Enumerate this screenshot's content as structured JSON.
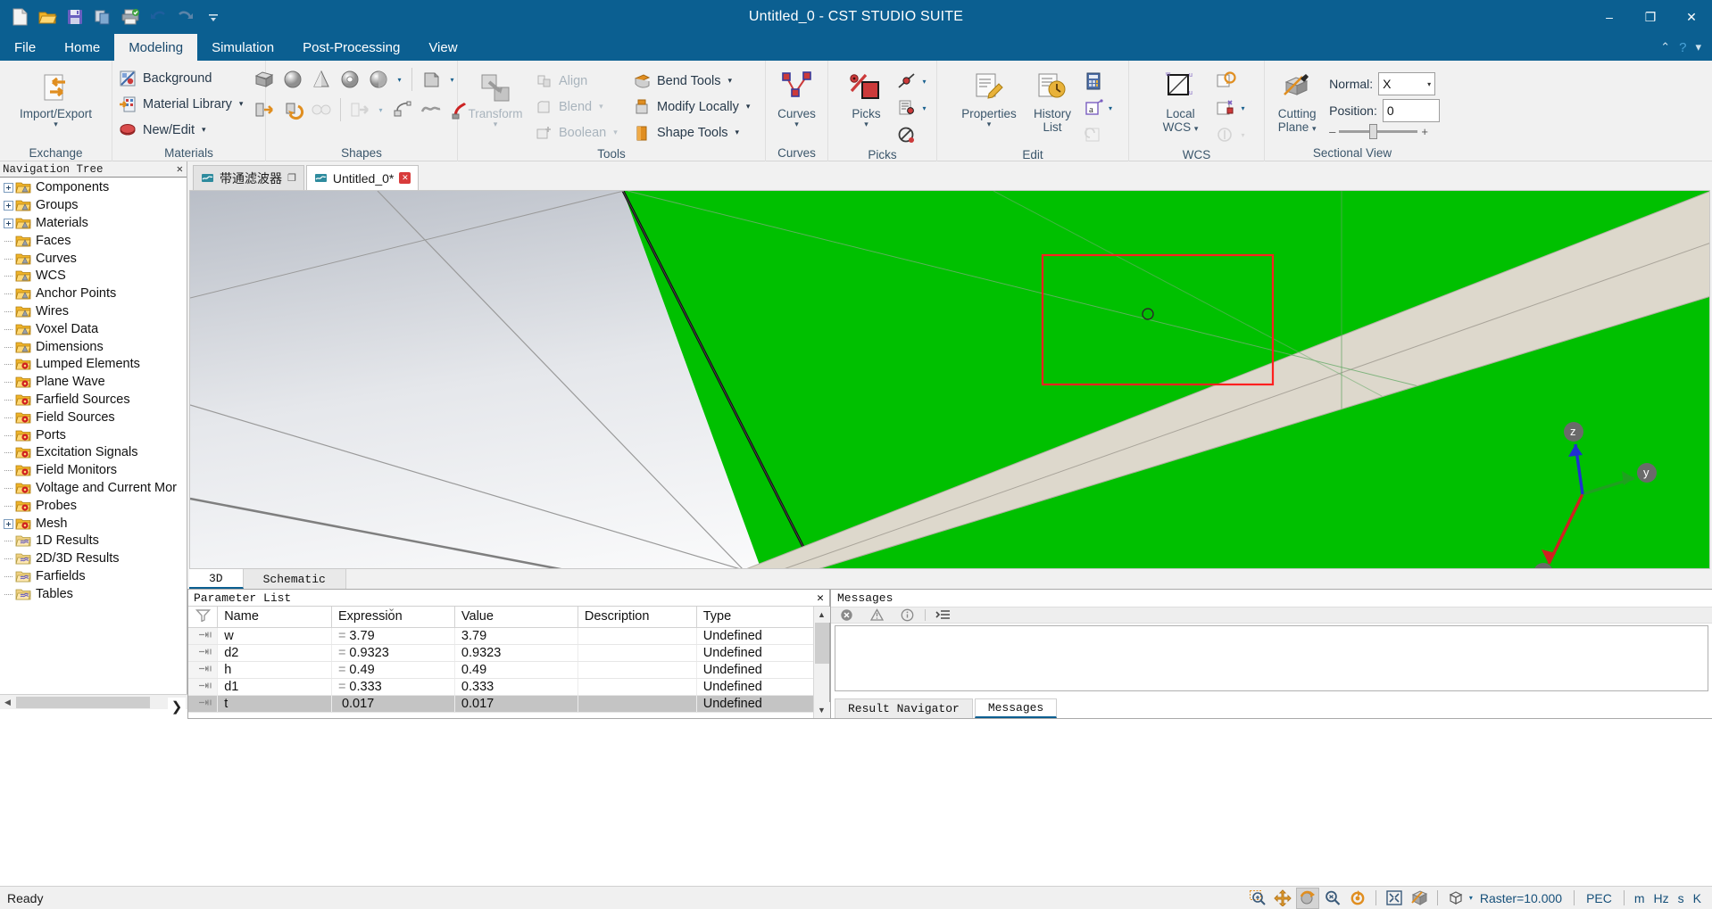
{
  "window": {
    "title": "Untitled_0 - CST STUDIO SUITE",
    "minimize": "–",
    "restore": "❐",
    "close": "✕"
  },
  "quick_access": [
    {
      "name": "new-document-icon",
      "tip": "New"
    },
    {
      "name": "open-folder-icon",
      "tip": "Open"
    },
    {
      "name": "save-icon",
      "tip": "Save"
    },
    {
      "name": "copy-icon",
      "tip": "Copy"
    },
    {
      "name": "print-icon",
      "tip": "Print"
    },
    {
      "name": "undo-icon",
      "tip": "Undo"
    },
    {
      "name": "redo-icon",
      "tip": "Redo"
    },
    {
      "name": "customize-qat-icon",
      "tip": "Customize"
    }
  ],
  "ribbon": {
    "tabs": [
      {
        "label": "File",
        "active": false
      },
      {
        "label": "Home",
        "active": false
      },
      {
        "label": "Modeling",
        "active": true
      },
      {
        "label": "Simulation",
        "active": false
      },
      {
        "label": "Post-Processing",
        "active": false
      },
      {
        "label": "View",
        "active": false
      }
    ],
    "help_icons": [
      {
        "name": "collapse-ribbon-icon",
        "glyph": "⌃"
      },
      {
        "name": "help-icon",
        "glyph": "?"
      },
      {
        "name": "ribbon-options-icon",
        "glyph": "▾"
      }
    ],
    "groups": {
      "exchange": {
        "label": "Exchange",
        "big_button": {
          "label": "Import/Export",
          "icon": "import-export-icon",
          "caret": "▾"
        }
      },
      "materials": {
        "label": "Materials",
        "items": [
          {
            "label": "Background",
            "icon": "background-icon",
            "dropdown": false,
            "disabled": false
          },
          {
            "label": "Material Library",
            "icon": "material-library-icon",
            "dropdown": true,
            "disabled": false
          },
          {
            "label": "New/Edit",
            "icon": "new-edit-material-icon",
            "dropdown": true,
            "disabled": false
          }
        ]
      },
      "shapes": {
        "label": "Shapes",
        "row1": [
          {
            "name": "brick-icon"
          },
          {
            "name": "sphere-icon"
          },
          {
            "name": "cone-icon"
          },
          {
            "name": "torus-icon"
          },
          {
            "name": "elliptical-cylinder-icon"
          },
          {
            "name": "shapes-more-caret",
            "caret": true
          },
          {
            "name": "extrude-icon"
          },
          {
            "name": "extrude-more-caret",
            "caret": true
          }
        ],
        "row2": [
          {
            "name": "extrude-curve-icon"
          },
          {
            "name": "rotate-icon"
          },
          {
            "name": "loft-icon",
            "disabled": true
          },
          {
            "name": "trace-from-curve-icon",
            "disabled": true
          },
          {
            "name": "trace-more-caret",
            "caret": true,
            "disabled": true
          },
          {
            "name": "wire-icon",
            "disabled": false
          },
          {
            "name": "curve-wire-icon"
          },
          {
            "name": "bond-wire-icon"
          }
        ]
      },
      "tools": {
        "label": "Tools",
        "big_button": {
          "label": "Transform",
          "icon": "transform-icon",
          "caret": "▾"
        },
        "col1": [
          {
            "label": "Align",
            "icon": "align-icon",
            "dropdown": false,
            "disabled": true
          },
          {
            "label": "Blend",
            "icon": "blend-icon",
            "dropdown": true,
            "disabled": true
          },
          {
            "label": "Boolean",
            "icon": "boolean-icon",
            "dropdown": true,
            "disabled": true
          }
        ],
        "col2": [
          {
            "label": "Bend Tools",
            "icon": "bend-tools-icon",
            "dropdown": true,
            "disabled": false
          },
          {
            "label": "Modify Locally",
            "icon": "modify-locally-icon",
            "dropdown": true,
            "disabled": false
          },
          {
            "label": "Shape Tools",
            "icon": "shape-tools-icon",
            "dropdown": true,
            "disabled": false
          }
        ]
      },
      "curves": {
        "label": "Curves",
        "big_button": {
          "label": "Curves",
          "icon": "curves-icon",
          "caret": "▾"
        }
      },
      "picks": {
        "label": "Picks",
        "big_button": {
          "label": "Picks",
          "icon": "picks-icon",
          "caret": "▾"
        },
        "side": [
          {
            "name": "pick-edge-icon",
            "caret": true
          },
          {
            "name": "pick-from-list-icon",
            "caret": true
          },
          {
            "name": "clear-picks-icon",
            "caret": false
          }
        ]
      },
      "edit": {
        "label": "Edit",
        "big_buttons": [
          {
            "label": "Properties",
            "icon": "properties-icon",
            "caret": "▾"
          },
          {
            "label": "History List",
            "icon": "history-list-icon",
            "caret": ""
          }
        ],
        "side": [
          {
            "name": "calculator-icon",
            "caret": false
          },
          {
            "name": "parameters-icon",
            "caret": true
          },
          {
            "name": "update-parametric-icon",
            "caret": false,
            "disabled": true
          }
        ]
      },
      "wcs": {
        "label": "WCS",
        "big_button": {
          "label": "Local WCS",
          "icon": "local-wcs-icon",
          "caret": "▾"
        },
        "side": [
          {
            "name": "transform-wcs-icon",
            "caret": false
          },
          {
            "name": "align-wcs-icon",
            "caret": true
          },
          {
            "name": "wcs-anchor-icon",
            "caret": true,
            "disabled": true
          }
        ]
      },
      "sectional_view": {
        "label": "Sectional View",
        "big_button": {
          "label": "Cutting Plane",
          "icon": "cutting-plane-icon",
          "caret": "▾"
        },
        "normal_label": "Normal:",
        "normal_value": "X",
        "position_label": "Position:",
        "position_value": "0",
        "slider_minus": "–",
        "slider_plus": "+"
      }
    }
  },
  "navigation_tree": {
    "title": "Navigation Tree",
    "close": "✕",
    "items": [
      {
        "label": "Components",
        "expandable": true,
        "icon": "folder-shape-icon"
      },
      {
        "label": "Groups",
        "expandable": true,
        "icon": "folder-shape-icon"
      },
      {
        "label": "Materials",
        "expandable": true,
        "icon": "folder-shape-icon"
      },
      {
        "label": "Faces",
        "expandable": false,
        "icon": "folder-shape-icon"
      },
      {
        "label": "Curves",
        "expandable": false,
        "icon": "folder-shape-icon"
      },
      {
        "label": "WCS",
        "expandable": false,
        "icon": "folder-shape-icon"
      },
      {
        "label": "Anchor Points",
        "expandable": false,
        "icon": "folder-shape-icon"
      },
      {
        "label": "Wires",
        "expandable": false,
        "icon": "folder-shape-icon"
      },
      {
        "label": "Voxel Data",
        "expandable": false,
        "icon": "folder-shape-icon"
      },
      {
        "label": "Dimensions",
        "expandable": false,
        "icon": "folder-shape-icon"
      },
      {
        "label": "Lumped Elements",
        "expandable": false,
        "icon": "folder-gear-icon"
      },
      {
        "label": "Plane Wave",
        "expandable": false,
        "icon": "folder-gear-icon"
      },
      {
        "label": "Farfield Sources",
        "expandable": false,
        "icon": "folder-gear-icon"
      },
      {
        "label": "Field Sources",
        "expandable": false,
        "icon": "folder-gear-icon"
      },
      {
        "label": "Ports",
        "expandable": false,
        "icon": "folder-gear-icon"
      },
      {
        "label": "Excitation Signals",
        "expandable": false,
        "icon": "folder-gear-icon"
      },
      {
        "label": "Field Monitors",
        "expandable": false,
        "icon": "folder-gear-icon"
      },
      {
        "label": "Voltage and Current Mor",
        "expandable": false,
        "icon": "folder-gear-icon"
      },
      {
        "label": "Probes",
        "expandable": false,
        "icon": "folder-gear-icon"
      },
      {
        "label": "Mesh",
        "expandable": true,
        "icon": "folder-gear-icon"
      },
      {
        "label": "1D Results",
        "expandable": false,
        "icon": "folder-results-icon"
      },
      {
        "label": "2D/3D Results",
        "expandable": false,
        "icon": "folder-results-icon"
      },
      {
        "label": "Farfields",
        "expandable": false,
        "icon": "folder-results-icon"
      },
      {
        "label": "Tables",
        "expandable": false,
        "icon": "folder-results-icon"
      }
    ],
    "scroll_left": "◀",
    "scroll_right": "▶"
  },
  "document_tabs": [
    {
      "label": "带通滤波器",
      "active": false,
      "close": "❐",
      "modified": false
    },
    {
      "label": "Untitled_0*",
      "active": true,
      "close": "✕",
      "modified": true
    }
  ],
  "view_tabs": [
    {
      "label": "3D",
      "active": true
    },
    {
      "label": "Schematic",
      "active": false
    }
  ],
  "parameter_list": {
    "title": "Parameter List",
    "close": "✕",
    "filter_icon": "filter-icon",
    "sort_indicator": "⌄",
    "columns": [
      "Name",
      "Expression",
      "Value",
      "Description",
      "Type"
    ],
    "rows": [
      {
        "name": "w",
        "eq": "=",
        "expression": "3.79",
        "value": "3.79",
        "description": "",
        "type": "Undefined",
        "selected": false
      },
      {
        "name": "d2",
        "eq": "=",
        "expression": "0.9323",
        "value": "0.9323",
        "description": "",
        "type": "Undefined",
        "selected": false
      },
      {
        "name": "h",
        "eq": "=",
        "expression": "0.49",
        "value": "0.49",
        "description": "",
        "type": "Undefined",
        "selected": false
      },
      {
        "name": "d1",
        "eq": "=",
        "expression": "0.333",
        "value": "0.333",
        "description": "",
        "type": "Undefined",
        "selected": false
      },
      {
        "name": "t",
        "eq": "",
        "expression": "0.017",
        "value": "0.017",
        "description": "",
        "type": "Undefined",
        "selected": true
      }
    ],
    "scroll_up": "▲",
    "scroll_down": "▼",
    "row_chevron": "⌄"
  },
  "messages_panel": {
    "title": "Messages",
    "toolbar": [
      {
        "name": "error-filter-icon"
      },
      {
        "name": "warning-filter-icon"
      },
      {
        "name": "info-filter-icon"
      },
      {
        "name": "message-details-icon"
      }
    ],
    "body_text": "",
    "tabs": [
      {
        "label": "Result Navigator",
        "active": false
      },
      {
        "label": "Messages",
        "active": true
      }
    ]
  },
  "status_bar": {
    "ready_text": "Ready",
    "buttons": [
      {
        "name": "zoom-box-icon",
        "active": false
      },
      {
        "name": "pan-icon",
        "active": false
      },
      {
        "name": "rotate-icon",
        "active": true
      },
      {
        "name": "zoom-icon",
        "active": false
      },
      {
        "name": "rotate-view-plane-icon",
        "active": false
      },
      {
        "name": "fit-to-screen-icon",
        "active": false
      },
      {
        "name": "view-plane-icon",
        "active": false
      },
      {
        "name": "bounding-box-icon",
        "active": false,
        "caret": true
      }
    ],
    "raster_text": "Raster=10.000",
    "boundary_text": "PEC",
    "units": [
      "m",
      "Hz",
      "s",
      "K"
    ]
  },
  "viewport": {
    "axis_labels": {
      "x": "x",
      "y": "y",
      "z": "z"
    },
    "selection_box_color": "#ff2020",
    "substrate_color": "#00c000",
    "trace_color": "#ddd8cc",
    "origin_marker": "circle"
  }
}
